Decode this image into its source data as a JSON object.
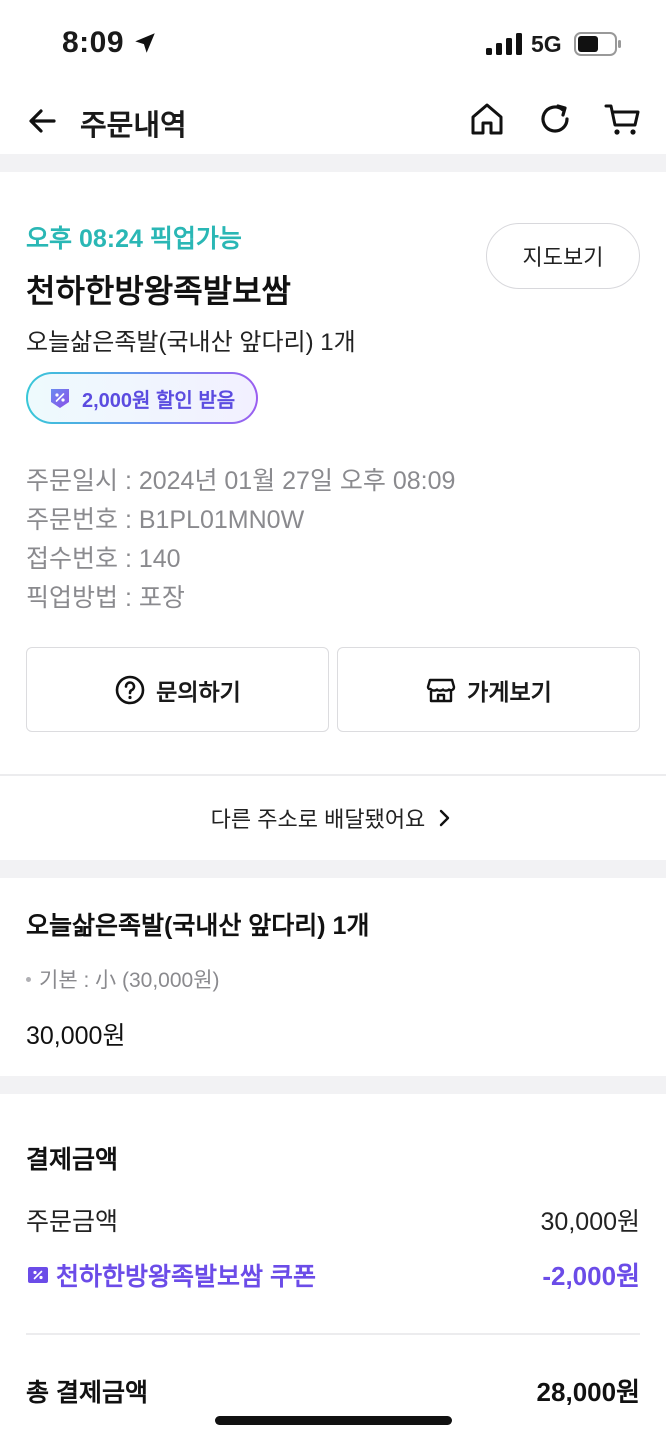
{
  "status_bar": {
    "time": "8:09",
    "network": "5G"
  },
  "header": {
    "title": "주문내역"
  },
  "order": {
    "pickup_time": "오후 08:24 픽업가능",
    "store_name": "천하한방왕족발보쌈",
    "item_summary": "오늘삶은족발(국내산 앞다리) 1개",
    "map_button": "지도보기",
    "discount_badge": "2,000원 할인 받음",
    "info": {
      "order_date": "주문일시 : 2024년 01월 27일 오후 08:09",
      "order_number": "주문번호 : B1PL01MN0W",
      "receipt_number": "접수번호 : 140",
      "pickup_method": "픽업방법 : 포장"
    },
    "inquiry_button": "문의하기",
    "store_button": "가게보기",
    "delivery_link": "다른 주소로 배달됐어요"
  },
  "item": {
    "name": "오늘삶은족발(국내산 앞다리) 1개",
    "option": "기본 : 小 (30,000원)",
    "price": "30,000원"
  },
  "payment": {
    "title": "결제금액",
    "order_amount_label": "주문금액",
    "order_amount": "30,000원",
    "coupon_label": "천하한방왕족발보쌈 쿠폰",
    "coupon_amount": "-2,000원",
    "total_label": "총 결제금액",
    "total_amount": "28,000원"
  },
  "colors": {
    "accent_teal": "#2ab7b5",
    "coupon_purple": "#6b4ce8",
    "info_gray": "#8a8a8e",
    "band_gray": "#f2f2f4"
  },
  "icons": [
    "location-arrow-icon",
    "signal-icon",
    "battery-icon",
    "back-arrow-icon",
    "home-icon",
    "refresh-icon",
    "cart-icon",
    "coupon-icon",
    "question-icon",
    "store-icon",
    "chevron-right-icon"
  ]
}
